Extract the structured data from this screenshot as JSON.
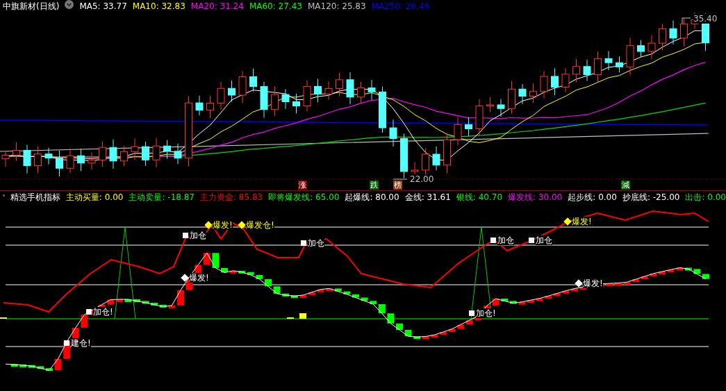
{
  "stock": {
    "name": "中旗新材(日线)"
  },
  "ma_legend": [
    {
      "label": "MA5:",
      "value": "33.77",
      "color": "#ffffff"
    },
    {
      "label": "MA10:",
      "value": "32.83",
      "color": "#ffff00"
    },
    {
      "label": "MA20:",
      "value": "31.24",
      "color": "#ff00ff"
    },
    {
      "label": "MA60:",
      "value": "27.43",
      "color": "#00ff00"
    },
    {
      "label": "MA120:",
      "value": "25.83",
      "color": "#c0c0c0"
    },
    {
      "label": "MA250:",
      "value": "26.46",
      "color": "#0000ff"
    }
  ],
  "price_labels": [
    "35.40",
    "22.00"
  ],
  "event_tags": [
    {
      "text": "涨",
      "color": "#8b0000"
    },
    {
      "text": "跌",
      "color": "#006400"
    },
    {
      "text": "榜",
      "color": "#8b4513"
    },
    {
      "text": "減",
      "color": "#006400"
    }
  ],
  "indicator": {
    "name": "精选手机指标",
    "legend": [
      {
        "label": "主动买量:",
        "value": "0.00",
        "color": "#ffff00"
      },
      {
        "label": "主动卖量:",
        "value": "-18.87",
        "color": "#00ff00"
      },
      {
        "label": "主力资金:",
        "value": "85.83",
        "color": "#ff0000"
      },
      {
        "label": "即将爆发线:",
        "value": "65.00",
        "color": "#00ff00"
      },
      {
        "label": "起爆线:",
        "value": "80.00",
        "color": "#ffffff"
      },
      {
        "label": "金线:",
        "value": "31.61",
        "color": "#ffffff"
      },
      {
        "label": "银线:",
        "value": "40.70",
        "color": "#00ff00"
      },
      {
        "label": "爆发线:",
        "value": "30.00",
        "color": "#ff00ff"
      },
      {
        "label": "起步线:",
        "value": "0.00",
        "color": "#ffffff"
      },
      {
        "label": "抄底线:",
        "value": "-25.00",
        "color": "#ffffff"
      },
      {
        "label": "出击:",
        "value": "0.00",
        "color": "#00ff00"
      }
    ],
    "signals": [
      {
        "kind": "square",
        "text": "建仓!",
        "color": "#ffffff"
      },
      {
        "kind": "square",
        "text": "加仓!",
        "color": "#ffffff"
      },
      {
        "kind": "diamond",
        "text": "爆发!",
        "color": "#ffffff"
      },
      {
        "kind": "square",
        "text": "加仓",
        "color": "#ffffff"
      },
      {
        "kind": "diamond",
        "text": "爆发!",
        "color": "#ffff00"
      },
      {
        "kind": "diamond",
        "text": "爆发仓!",
        "color": "#ffff00"
      },
      {
        "kind": "square",
        "text": "加仓",
        "color": "#ffffff"
      },
      {
        "kind": "square",
        "text": "加仓!",
        "color": "#ffffff"
      },
      {
        "kind": "square",
        "text": "加仓",
        "color": "#ffffff"
      },
      {
        "kind": "square",
        "text": "加仓",
        "color": "#ffffff"
      },
      {
        "kind": "diamond",
        "text": "爆发!",
        "color": "#ffff00"
      },
      {
        "kind": "diamond",
        "text": "爆发!",
        "color": "#ffffff"
      }
    ]
  }
}
